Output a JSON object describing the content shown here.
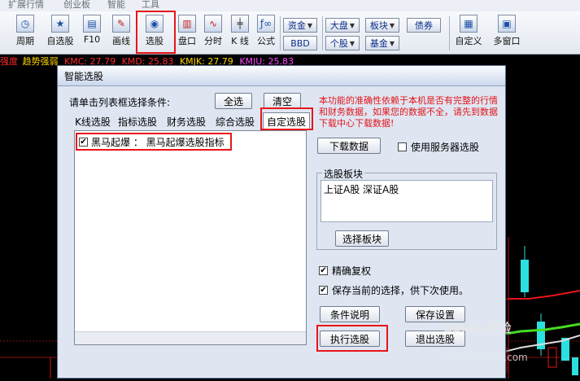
{
  "menubar": {
    "items": [
      "扩展行情",
      "创业板",
      "智能",
      "工具"
    ]
  },
  "toolbar": {
    "buttons": {
      "period": "周期",
      "self_stock": "自选股",
      "f10": "F10",
      "draw": "画线",
      "select": "选股",
      "handicap": "盘口",
      "minute": "分时",
      "kline": "K 线",
      "formula": "公式",
      "custom": "自定义",
      "multiwin": "多窗口"
    },
    "small_buttons": {
      "funds": "资金",
      "bbd": "BBD",
      "market": "大盘",
      "individual": "个股",
      "sector": "板块",
      "fund": "基金",
      "bonds": "债券"
    }
  },
  "indicators": {
    "prefix": "强度",
    "name": "趋势强弱",
    "kmc": "KMC: 27.79",
    "kmd": "KMD: 25.83",
    "kmjk": "KMJK: 27.79",
    "kmju": "KMJU: 25.83"
  },
  "dialog": {
    "title": "智能选股",
    "prompt": "请单击列表框选择条件:",
    "select_all": "全选",
    "clear": "清空",
    "tabs": [
      "K线选股",
      "指标选股",
      "财务选股",
      "综合选股",
      "自定选股"
    ],
    "list_item": "黑马起爆 ： 黑马起爆选股指标",
    "warning": "本功能的准确性依赖于本机是否有完整的行情和财务数据，如果您的数据不全，请先到数据下载中心下载数据!",
    "download": "下载数据",
    "use_server": "使用服务器选股",
    "group_title": "选股板块",
    "group_content": "上证A股 深证A股",
    "choose_sector": "选择板块",
    "precise": "精确复权",
    "save_selection": "保存当前的选择，供下次使用。",
    "condition_desc": "条件说明",
    "save_settings": "保存设置",
    "execute": "执行选股",
    "exit": "退出选股"
  },
  "watermark": {
    "line1": "Baidu 经验",
    "line2": "jingyan.baidu.com"
  },
  "colors": {
    "highlight": "#e8151a",
    "up": "#e8151a",
    "down": "#2be0e0",
    "ma": "#44dd22",
    "warning": "#e3151b"
  }
}
